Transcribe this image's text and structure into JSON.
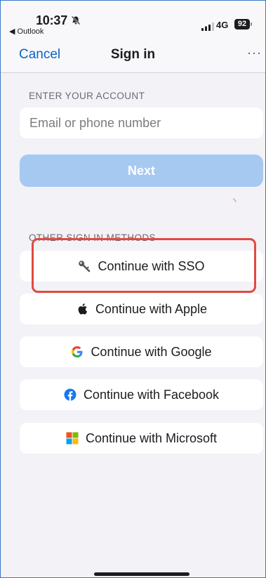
{
  "status_bar": {
    "time": "10:37",
    "back_app": "◀ Outlook",
    "network": "4G",
    "battery": "92"
  },
  "nav": {
    "cancel_label": "Cancel",
    "title": "Sign in",
    "more_label": "···"
  },
  "account": {
    "section_label": "ENTER YOUR ACCOUNT",
    "email_placeholder": "Email or phone number",
    "email_value": "",
    "next_label": "Next"
  },
  "other_methods": {
    "section_label": "OTHER SIGN IN METHODS",
    "buttons": [
      {
        "label": "Continue with SSO",
        "icon": "key-icon"
      },
      {
        "label": "Continue with Apple",
        "icon": "apple-icon"
      },
      {
        "label": "Continue with Google",
        "icon": "google-icon"
      },
      {
        "label": "Continue with Facebook",
        "icon": "facebook-icon"
      },
      {
        "label": "Continue with Microsoft",
        "icon": "microsoft-icon"
      }
    ]
  },
  "colors": {
    "accent": "#0a64c2",
    "next_disabled": "#a6c9f2",
    "highlight": "#e04a3f",
    "background": "#f2f2f7"
  }
}
